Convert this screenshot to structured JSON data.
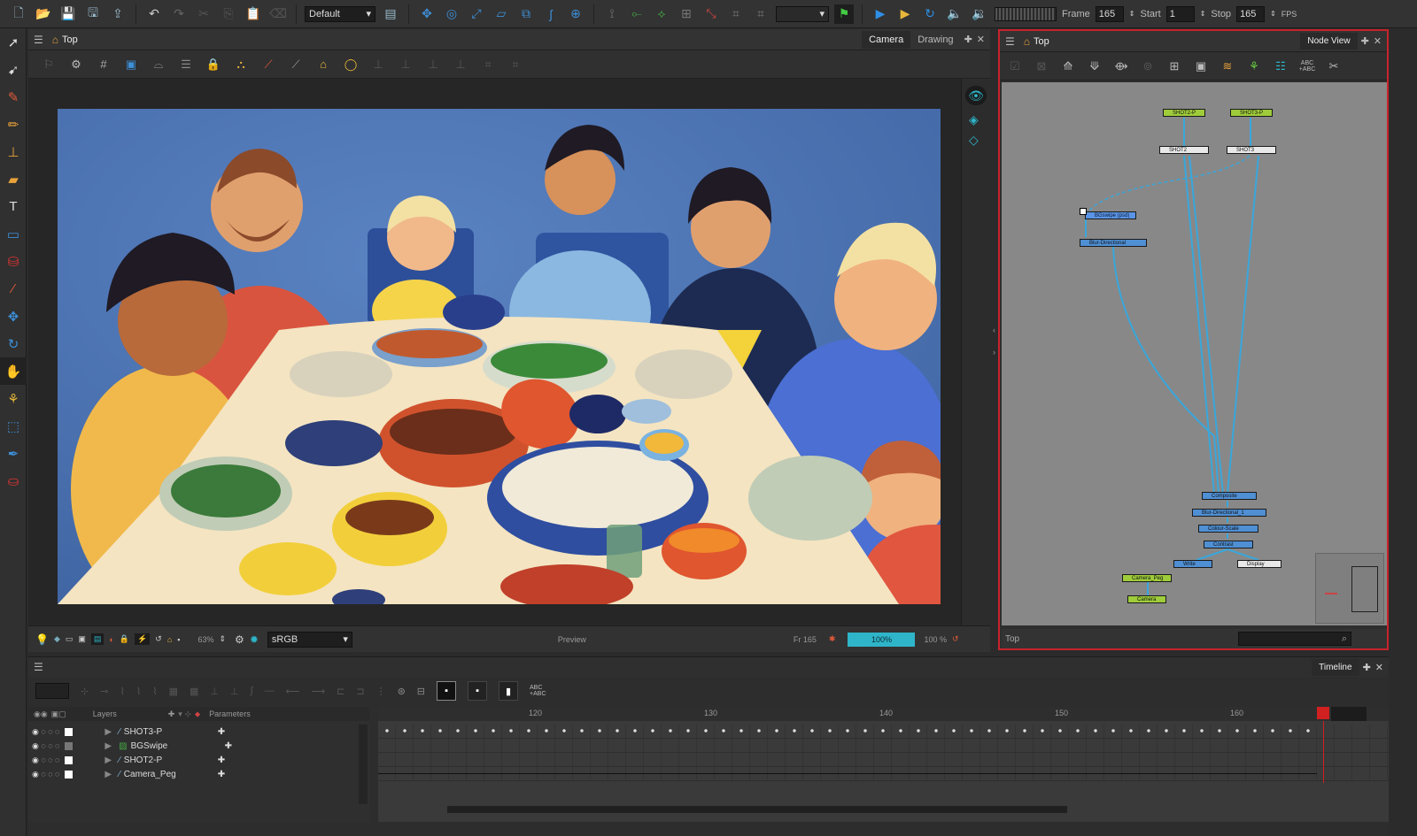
{
  "topbar": {
    "workspace": "Default",
    "frame_label": "Frame",
    "frame_value": "165",
    "start_label": "Start",
    "start_value": "1",
    "stop_label": "Stop",
    "stop_value": "165",
    "fps_label": "FPS"
  },
  "camera_view": {
    "breadcrumb": "Top",
    "tabs": [
      "Camera",
      "Drawing"
    ],
    "active_tab": "Camera",
    "zoom_value": "63%",
    "colorspace": "sRGB",
    "preview_label": "Preview",
    "frame_indicator": "Fr 165",
    "zoom_bar": "100%",
    "zoom_pct": "100 %"
  },
  "node_view": {
    "breadcrumb": "Top",
    "tab": "Node View",
    "footer_label": "Top",
    "nodes": {
      "shot2_p": "SHOT2-P",
      "shot3_p": "SHOT3-P",
      "shot2": "SHOT2",
      "shot3": "SHOT3",
      "bgswipe": "BGswipe (psd)",
      "blur_directional": "Blur-Directional",
      "composite": "Composite",
      "blur_directional_1": "Blur-Directional_1",
      "colour_scale": "Colour-Scale",
      "contrast": "Contrast",
      "write": "Write",
      "display": "Display",
      "camera_peg": "Camera_Peg",
      "camera": "Camera"
    }
  },
  "timeline": {
    "tab": "Timeline",
    "layers_header": "Layers",
    "parameters_header": "Parameters",
    "ruler": [
      "120",
      "130",
      "140",
      "150",
      "160"
    ],
    "layers": [
      "SHOT3-P",
      "BGSwipe",
      "SHOT2-P",
      "Camera_Peg"
    ],
    "abc_label": "ABC",
    "abc_sub": "+ABC"
  },
  "colors": {
    "accent": "#2fb5c9",
    "node_green": "#9fcc3a",
    "node_blue": "#4f8fd4",
    "selection_red": "#c8232c",
    "playhead": "#d02020"
  }
}
